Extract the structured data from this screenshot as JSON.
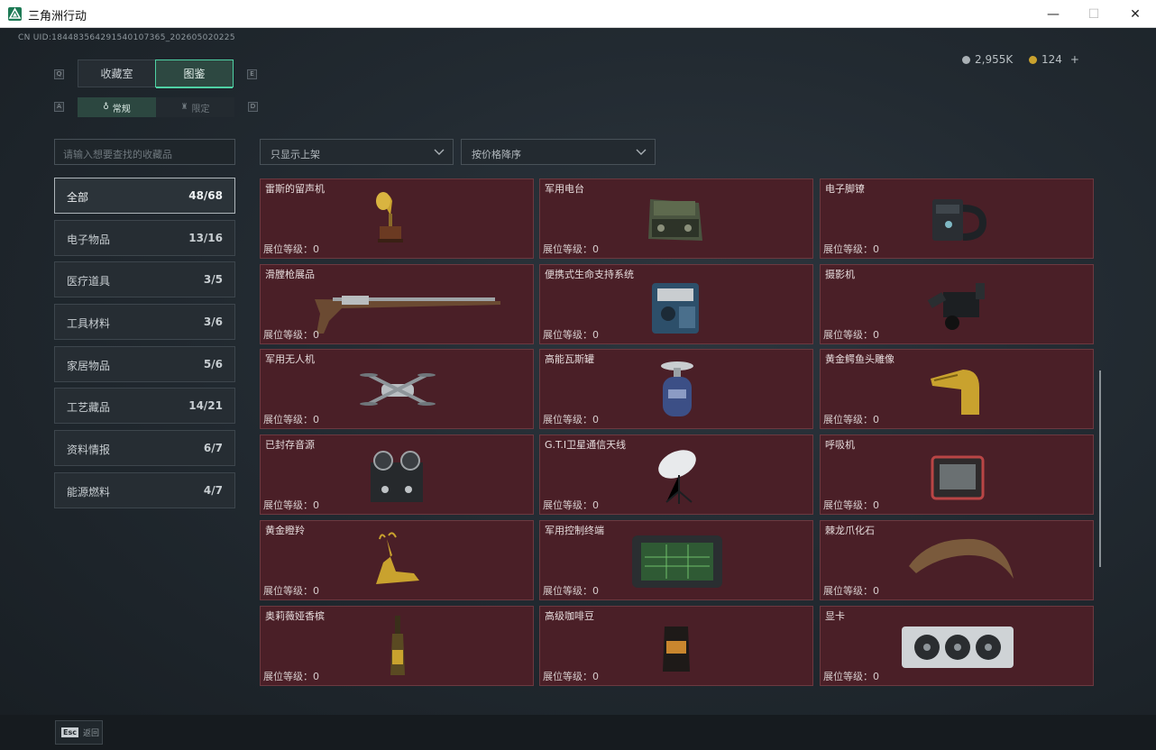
{
  "window": {
    "title": "三角洲行动",
    "minimize_glyph": "—",
    "maximize_glyph": "☐",
    "close_glyph": "✕"
  },
  "header": {
    "uid": "CN UID:184483564291540107365_202605020225",
    "currency_silver": "2,955K",
    "currency_gold": "124",
    "add_glyph": "+"
  },
  "key_hints": {
    "left_top": "Q",
    "right_top": "E",
    "left_sub": "A",
    "right_sub": "D"
  },
  "tabs": [
    {
      "label": "收藏室",
      "active": false
    },
    {
      "label": "图鉴",
      "active": true
    }
  ],
  "subtabs": [
    {
      "label": "常规",
      "active": true
    },
    {
      "label": "限定",
      "active": false
    }
  ],
  "search": {
    "placeholder": "请输入想要查找的收藏品"
  },
  "filters": [
    {
      "label": "只显示上架"
    },
    {
      "label": "按价格降序"
    }
  ],
  "categories": [
    {
      "name": "全部",
      "count": "48/68",
      "active": true
    },
    {
      "name": "电子物品",
      "count": "13/16",
      "active": false
    },
    {
      "name": "医疗道具",
      "count": "3/5",
      "active": false
    },
    {
      "name": "工具材料",
      "count": "3/6",
      "active": false
    },
    {
      "name": "家居物品",
      "count": "5/6",
      "active": false
    },
    {
      "name": "工艺藏品",
      "count": "14/21",
      "active": false
    },
    {
      "name": "资料情报",
      "count": "6/7",
      "active": false
    },
    {
      "name": "能源燃料",
      "count": "4/7",
      "active": false
    }
  ],
  "items": [
    {
      "name": "雷斯的留声机",
      "level": "展位等级：0",
      "icon": "gramophone-icon"
    },
    {
      "name": "军用电台",
      "level": "展位等级：0",
      "icon": "military-radio-icon"
    },
    {
      "name": "电子脚镣",
      "level": "展位等级：0",
      "icon": "ankle-monitor-icon"
    },
    {
      "name": "滑膛枪展品",
      "level": "展位等级：0",
      "icon": "musket-icon"
    },
    {
      "name": "便携式生命支持系统",
      "level": "展位等级：0",
      "icon": "life-support-icon"
    },
    {
      "name": "摄影机",
      "level": "展位等级：0",
      "icon": "camera-icon"
    },
    {
      "name": "军用无人机",
      "level": "展位等级：0",
      "icon": "drone-icon"
    },
    {
      "name": "高能瓦斯罐",
      "level": "展位等级：0",
      "icon": "gas-tank-icon"
    },
    {
      "name": "黄金鳄鱼头雕像",
      "level": "展位等级：0",
      "icon": "gold-crocodile-icon"
    },
    {
      "name": "已封存音源",
      "level": "展位等级：0",
      "icon": "tape-recorder-icon"
    },
    {
      "name": "G.T.I卫星通信天线",
      "level": "展位等级：0",
      "icon": "satellite-dish-icon"
    },
    {
      "name": "呼吸机",
      "level": "展位等级：0",
      "icon": "ventilator-icon"
    },
    {
      "name": "黄金瞪羚",
      "level": "展位等级：0",
      "icon": "gold-gazelle-icon"
    },
    {
      "name": "军用控制终端",
      "level": "展位等级：0",
      "icon": "control-terminal-icon"
    },
    {
      "name": "棘龙爪化石",
      "level": "展位等级：0",
      "icon": "claw-fossil-icon"
    },
    {
      "name": "奥莉薇娅香槟",
      "level": "展位等级：0",
      "icon": "champagne-icon"
    },
    {
      "name": "高级咖啡豆",
      "level": "展位等级：0",
      "icon": "coffee-bag-icon"
    },
    {
      "name": "显卡",
      "level": "展位等级：0",
      "icon": "graphics-card-icon"
    }
  ],
  "footer": {
    "esc_key": "Esc",
    "esc_label": "返回"
  },
  "colors": {
    "accent": "#4fd1a4",
    "card_bg": "#4a1f27",
    "gold": "#c9a22e"
  }
}
